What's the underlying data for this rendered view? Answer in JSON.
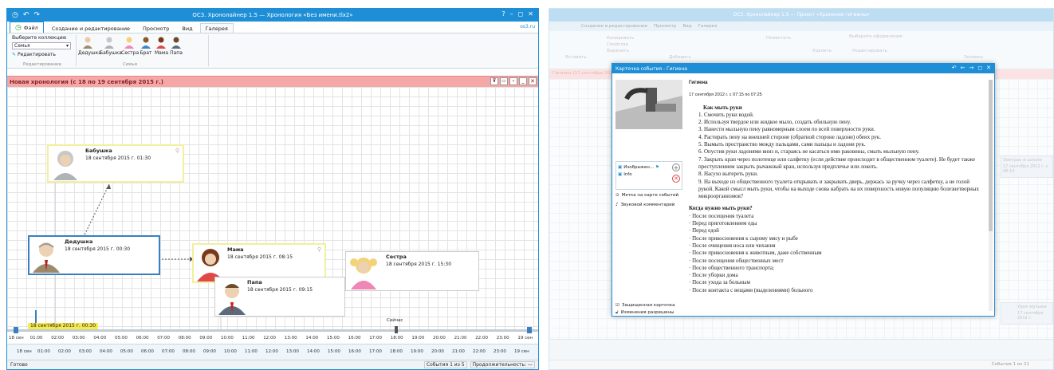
{
  "left_window": {
    "title": "ОС3. Хронолайнер 1.5 — Хронология «Без имени.tlx2»",
    "title_icons": [
      "clock-icon",
      "arrow-back-icon",
      "arrow-forward-icon"
    ],
    "controls": [
      "?",
      "–",
      "◻",
      "✕"
    ],
    "file_tab": "Файл",
    "tabs": [
      "Создание и редактирование",
      "Просмотр",
      "Вид",
      "Галерея"
    ],
    "site": "os3.ru",
    "ribbon": {
      "collection_label": "Выберите коллекцию",
      "collection_value": "Семья",
      "edit_label": "Редактировать",
      "group_edit": "Редактирование",
      "group_family": "Семья",
      "gallery": [
        "Дедушка",
        "Бабушка",
        "Сестра",
        "Брат",
        "Мама",
        "Папа"
      ]
    },
    "band_title": "Новая хронология (с 18 по 19 сентября 2015 г.)",
    "events": [
      {
        "name": "Бабушка",
        "date": "18 сентября 2015 г. 01:30"
      },
      {
        "name": "Дедушка",
        "date": "18 сентября 2015 г. 00:30"
      },
      {
        "name": "Мама",
        "date": "18 сентября 2015 г. 08:15"
      },
      {
        "name": "Сестра",
        "date": "18 сентября 2015 г. 15:30"
      },
      {
        "name": "Папа",
        "date": "18 сентября 2015 г. 09:15"
      }
    ],
    "cursor_label": "18 сентября 2015 г. 00:30",
    "now_label": "Сейчас",
    "ruler_top": [
      "18 сен",
      "01:00",
      "02:00",
      "03:00",
      "04:00",
      "05:00",
      "06:00",
      "07:00",
      "08:00",
      "09:00",
      "10:00",
      "11:00",
      "12:00",
      "13:00",
      "14:00",
      "15:00",
      "16:00",
      "17:00",
      "18:00",
      "19:00",
      "20:00",
      "21:00",
      "22:00",
      "23:00",
      "19 сен"
    ],
    "ruler_bottom": [
      "18 сен",
      "01:00",
      "02:00",
      "03:00",
      "04:00",
      "05:00",
      "06:00",
      "07:00",
      "08:00",
      "09:00",
      "10:00",
      "11:00",
      "12:00",
      "13:00",
      "14:00",
      "15:00",
      "16:00",
      "17:00",
      "18:00",
      "19:00",
      "20:00",
      "21:00",
      "22:00",
      "23:00",
      "19 сен"
    ],
    "status_left": "Готово",
    "status_events": "События 1 из 5",
    "status_duration": "Продолжительность: —"
  },
  "right_window": {
    "title": "ОС3. Хронолайнер 1.5 — Проект «Хранение гигиены»",
    "tabs": [
      "Создание и редактирование",
      "Просмотр",
      "Вид",
      "Галерея"
    ],
    "ribbon_items": [
      "Вставить",
      "Копировать",
      "Вырезать",
      "Добавить",
      "Свойства",
      "Удалить",
      "Поместить",
      "Редактировать",
      "Выберите оформление",
      "Заливка"
    ],
    "bg_events": [
      "Гигиена (17 сентября 2012 г.)",
      "Завтрак в школе",
      "17 сентября 2012 г. с 08:10",
      "Урок музыки",
      "17 сентября 2012 г."
    ],
    "status": "События 1 из 21",
    "dialog": {
      "title": "Карточка события - Гигиена",
      "heading": "Гигиена",
      "date": "17 сентября 2012 г. с 07:15 по 07:25",
      "attachments": [
        "Изображен...",
        "Info"
      ],
      "map_label": "Метка на карте событий",
      "audio_label": "Звуковой комментарий",
      "protected_label": "Защищенная карточка",
      "permissions_label": "Изменения разрешены",
      "doc_title1": "Как мыть руки",
      "steps": [
        "1. Смочить руки водой.",
        "2. Используя твердое или жидкое мыло, создать обильную пену.",
        "3. Нанести мыльную пену равномерным слоем по всей поверхности руки.",
        "4. Растирать пену на внешней стороне (обратной стороне ладони) обеих рук.",
        "5. Вымыть пространство между пальцами, сами пальцы и ладони рук.",
        "6. Опустив руки ладонями вниз и, стараясь не касаться ими раковины, смыть мыльную пену.",
        "7. Закрыть кран через полотенце или салфетку (если действие происходит в общественном туалете). Не будет также преступлением закрыть рычажный кран, используя предплечье или локоть.",
        "8. Насухо вытереть руки.",
        "9. На выходе из общественного туалета открывать и закрывать дверь, держась за ручку через салфетку, а не голой рукой. Какой смысл мыть руки, чтобы на выходе снова набрать на их поверхность новую популяцию болезнетворных микроорганизмов?"
      ],
      "doc_title2": "Когда нужно мыть руки?",
      "list": [
        "· После посещения туалета",
        "· Перед приготовлением еды",
        "· Перед едой",
        "· После прикосновения к сырому мясу и рыбе",
        "· После очищения носа или чихания",
        "· После прикосновения к животным, даже собственным",
        "· После посещения общественных мест",
        "· После общественного транспорта;",
        "· После уборки дома",
        "· После ухода за больным",
        "· После контакта с вещами (выделениями) больного"
      ]
    }
  },
  "colors": {
    "accent": "#1e8fd6",
    "band": "#f4a9a8",
    "card_yellow": "#f3ef9c",
    "card_blue": "#3a7fc0"
  }
}
